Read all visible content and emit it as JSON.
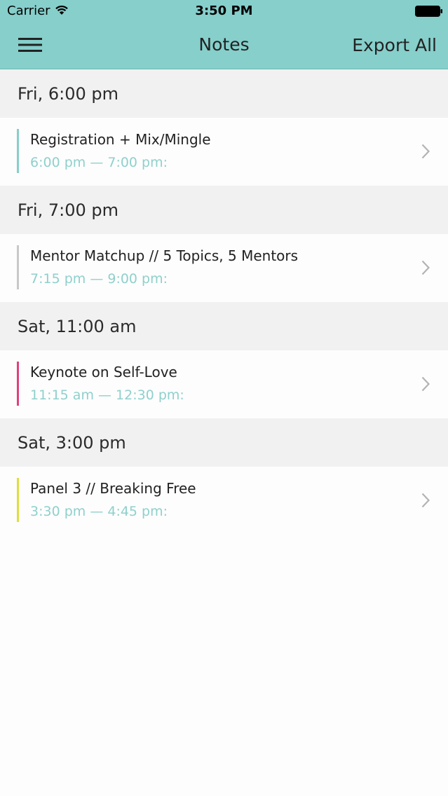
{
  "status_bar": {
    "carrier": "Carrier",
    "time": "3:50 PM",
    "wifi_icon": "wifi-icon",
    "battery_icon": "battery-icon"
  },
  "nav": {
    "menu_icon": "hamburger-menu-icon",
    "title": "Notes",
    "export_label": "Export All"
  },
  "colors": {
    "header_bg": "#86cfcb",
    "time_text": "#8fd0cc",
    "section_bg": "#f1f1f1"
  },
  "sections": [
    {
      "header": "Fri, 6:00 pm",
      "note": {
        "title": "Registration + Mix/Mingle",
        "time": "6:00 pm — 7:00 pm:",
        "accent_color": "#86cfcb"
      }
    },
    {
      "header": "Fri, 7:00 pm",
      "note": {
        "title": "Mentor Matchup // 5 Topics, 5 Mentors",
        "time": "7:15 pm — 9:00 pm:",
        "accent_color": "#c8c8c8"
      }
    },
    {
      "header": "Sat, 11:00 am",
      "note": {
        "title": "Keynote on Self-Love",
        "time": "11:15 am — 12:30 pm:",
        "accent_color": "#e0407a"
      }
    },
    {
      "header": "Sat, 3:00 pm",
      "note": {
        "title": "Panel 3 // Breaking Free",
        "time": "3:30 pm — 4:45 pm:",
        "accent_color": "#e0de3c"
      }
    }
  ]
}
